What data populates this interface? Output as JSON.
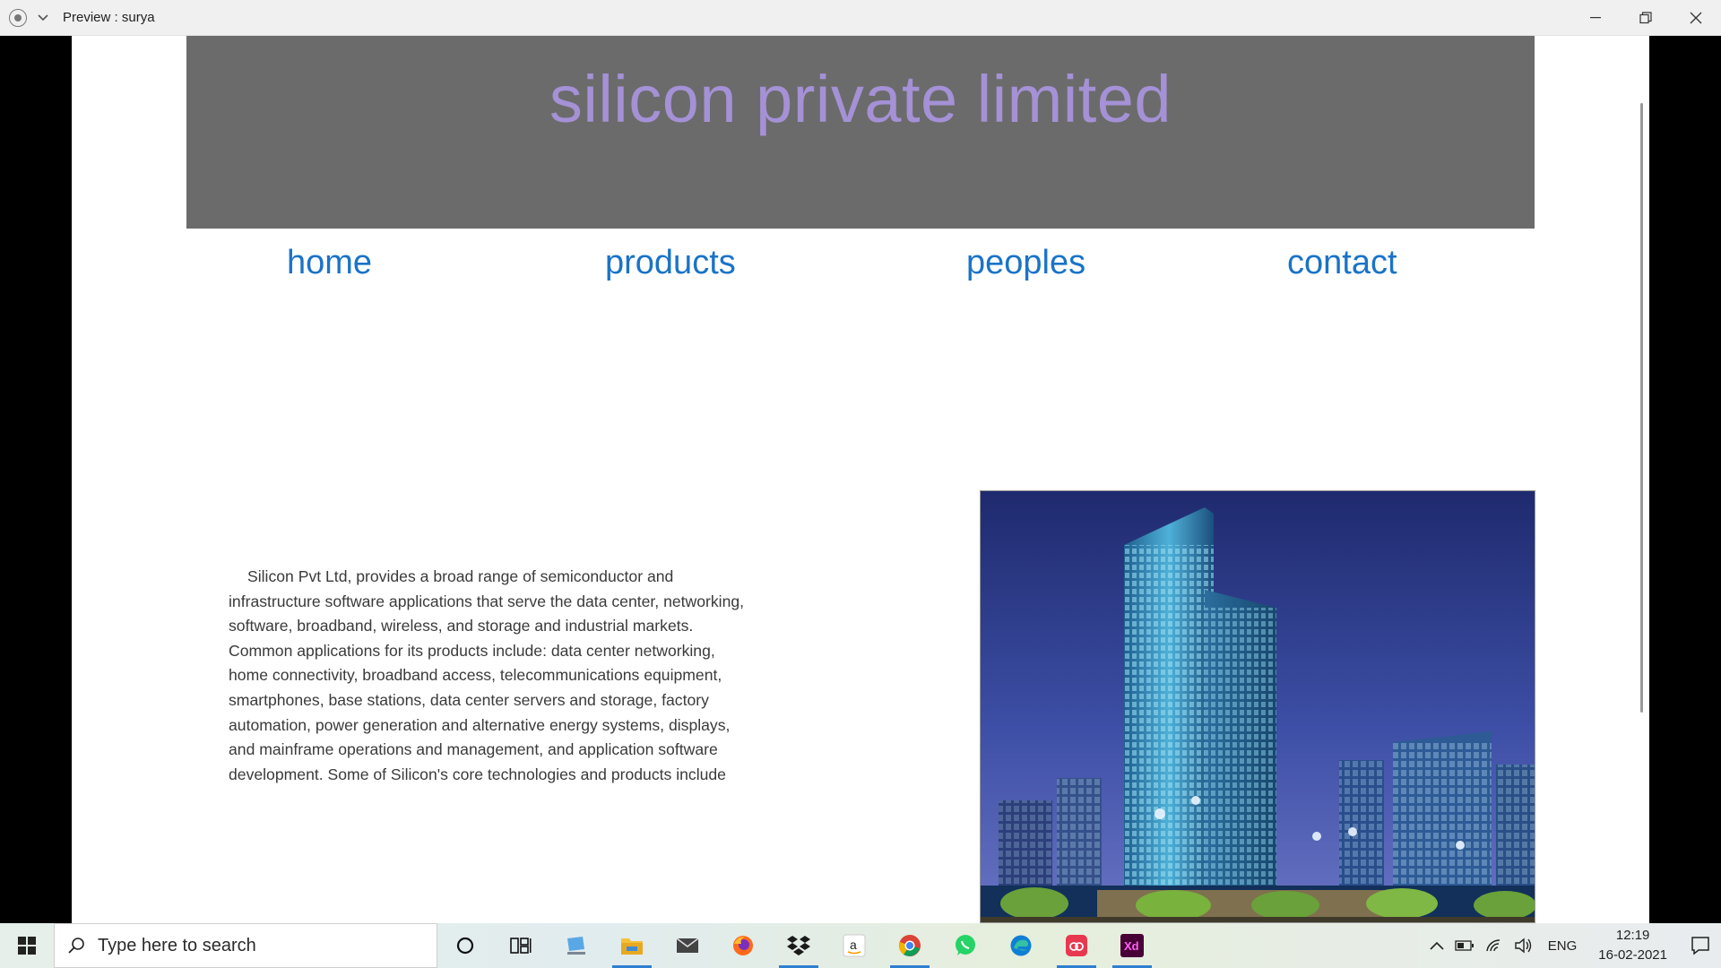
{
  "window": {
    "title": "Preview : surya"
  },
  "site": {
    "banner_title": "silicon private limited",
    "nav": [
      "home",
      "products",
      "peoples",
      "contact"
    ],
    "about_text": "Silicon Pvt Ltd, provides a broad range of semiconductor and infrastructure software applications that serve the data center, networking, software, broadband, wireless, and storage and industrial markets. Common applications for its products include: data center networking, home connectivity, broadband access, telecommunications equipment, smartphones, base stations, data center servers and storage, factory automation, power generation and alternative energy systems, displays, and mainframe operations and management, and application software development. Some of Silicon's core technologies and products include",
    "image_subject": "city-skyscraper-night"
  },
  "taskbar": {
    "search_placeholder": "Type here to search",
    "apps": [
      {
        "icon": "cortana-icon",
        "active": false
      },
      {
        "icon": "task-view-icon",
        "active": false
      },
      {
        "icon": "this-pc-icon",
        "active": false
      },
      {
        "icon": "file-explorer-icon",
        "active": true
      },
      {
        "icon": "mail-icon",
        "active": false
      },
      {
        "icon": "firefox-icon",
        "active": false
      },
      {
        "icon": "dropbox-icon",
        "active": true
      },
      {
        "icon": "amazon-icon",
        "active": false
      },
      {
        "icon": "chrome-icon",
        "active": true
      },
      {
        "icon": "whatsapp-icon",
        "active": false
      },
      {
        "icon": "edge-icon",
        "active": false
      },
      {
        "icon": "creative-cloud-icon",
        "active": true
      },
      {
        "icon": "adobe-xd-icon",
        "active": true
      }
    ],
    "language": "ENG",
    "time": "12:19",
    "date": "16-02-2021"
  },
  "colors": {
    "banner_bg": "#6b6b6b",
    "banner_text": "#a491d6",
    "nav_link": "#1a73c8"
  }
}
